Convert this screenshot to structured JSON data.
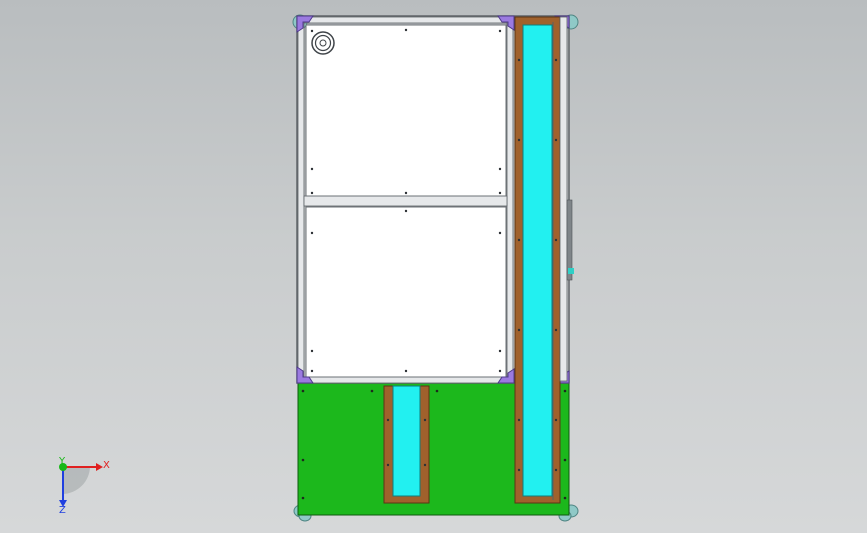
{
  "view": {
    "axes": {
      "x": "X",
      "y": "Y",
      "z": "Z"
    },
    "colors": {
      "background": "#c4c7c8",
      "frame": "#7a7f84",
      "panel": "#ffffff",
      "base_plate": "#1cb81c",
      "conveyor_belt": "#22f0f0",
      "wood_rail": "#a0612c",
      "corner_bracket": "#9b7ae0",
      "foot": "#8fc9c7",
      "axis_x": "#e02020",
      "axis_y": "#18b818",
      "axis_z": "#2040e0"
    }
  }
}
